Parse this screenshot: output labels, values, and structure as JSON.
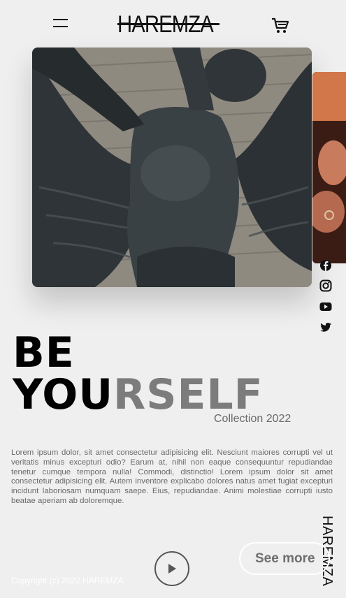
{
  "header": {
    "logo": "HAREMZA",
    "menu_icon": "hamburger-menu-icon",
    "cart_icon": "shopping-cart-icon"
  },
  "hero": {
    "image": "angel-statue-photo",
    "side_image": "hands-with-ring-photo"
  },
  "social": [
    "facebook-icon",
    "instagram-icon",
    "youtube-icon",
    "twitter-icon"
  ],
  "headline": {
    "line1": "BE",
    "line2_dark": "YOU",
    "line2_grey": "RSELF"
  },
  "collection": "Collection 2022",
  "description": "Lorem ipsum dolor, sit amet consectetur adipisicing elit. Nesciunt maiores corrupti vel ut veritatis minus excepturi odio? Earum at, nihil non eaque consequuntur repudiandae tenetur cumque tempora nulla! Commodi, distinctio! Lorem ipsum dolor sit amet consectetur adipisicing elit. Autem inventore explicabo dolores natus amet fugiat excepturi incidunt laboriosam numquam saepe. Eius, repudiandae. Animi molestiae corrupti iusto beatae aperiam ab doloremque.",
  "vertical_brand": "HAREMZA",
  "actions": {
    "see_more": "See more",
    "play_icon": "play-icon"
  },
  "footer": {
    "copyright": "Copyright (c) 2022 HAREMZA"
  },
  "colors": {
    "background": "#efefef",
    "headline_dark": "#000000",
    "headline_grey": "#7c7c7c"
  }
}
